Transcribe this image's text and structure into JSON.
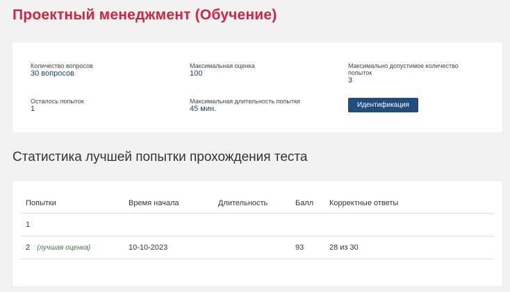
{
  "page": {
    "title": "Проектный менеджмент (Обучение)"
  },
  "info": {
    "questions_label": "Количество вопросов",
    "questions_value": "30 вопросов",
    "max_score_label": "Максимальная оценка",
    "max_score_value": "100",
    "max_attempts_label": "Максимально допустимое количество попыток",
    "max_attempts_value": "3",
    "attempts_left_label": "Осталось попыток",
    "attempts_left_value": "1",
    "max_duration_label": "Максимальная длительность попытки",
    "max_duration_value": "45 мин.",
    "identify_button": "Идентификация"
  },
  "stats": {
    "section_title": "Статистика лучшей попытки прохождения теста",
    "columns": {
      "attempts": "Попытки",
      "start_time": "Время начала",
      "duration": "Длительность",
      "score": "Балл",
      "correct": "Корректные ответы"
    },
    "rows": [
      {
        "attempt": "1",
        "note": "",
        "start_time": "",
        "duration": "",
        "score": "",
        "correct": ""
      },
      {
        "attempt": "2",
        "note": "(лучшая оценка)",
        "start_time": "10-10-2023",
        "duration": "",
        "score": "93",
        "correct": "28 из 30"
      }
    ]
  },
  "colors": {
    "title_red": "#d2233f",
    "button_blue": "#1f4e7e",
    "best_note_green": "#3a7a3a"
  }
}
